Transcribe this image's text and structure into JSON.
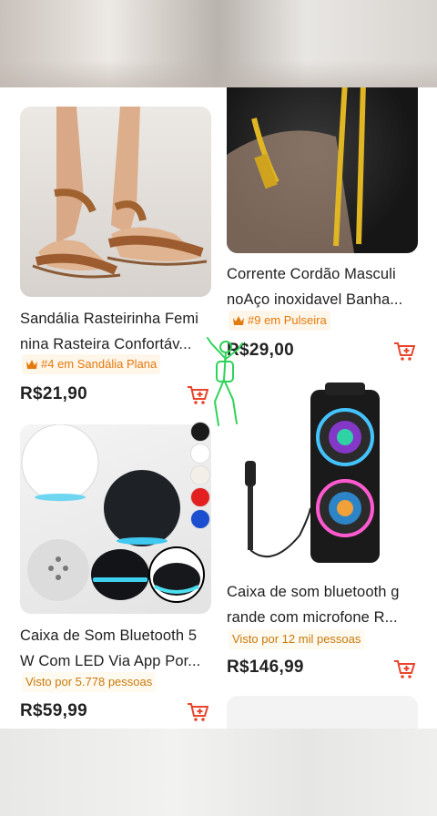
{
  "products": [
    {
      "title_line1": "Sandália Rasteirinha Femi",
      "title_line2": "nina Rasteira Confortáv...",
      "badge": "#4 em Sandália Plana",
      "price": "R$21,90"
    },
    {
      "title_line1": "Corrente Cordão Masculi",
      "title_line2": "noAço inoxidavel Banha...",
      "badge": "#9 em Pulseira",
      "price": "R$29,00"
    },
    {
      "title_line1": "Caixa de Som Bluetooth 5",
      "title_line2": "W Com LED Via App Por...",
      "badge": "Visto por 5.778 pessoas",
      "price": "R$59,99"
    },
    {
      "title_line1": "Caixa de som bluetooth g",
      "title_line2": "rande com microfone R...",
      "badge": "Visto por 12 mil pessoas",
      "price": "R$146,99"
    }
  ],
  "colors": {
    "price": "#222222",
    "badge_rank": "#e27a0e",
    "cart_icon": "#e8442b",
    "swatches": [
      "#1a1a1a",
      "#ffffff",
      "#f3efe8",
      "#e32020",
      "#1c4fd0"
    ]
  }
}
